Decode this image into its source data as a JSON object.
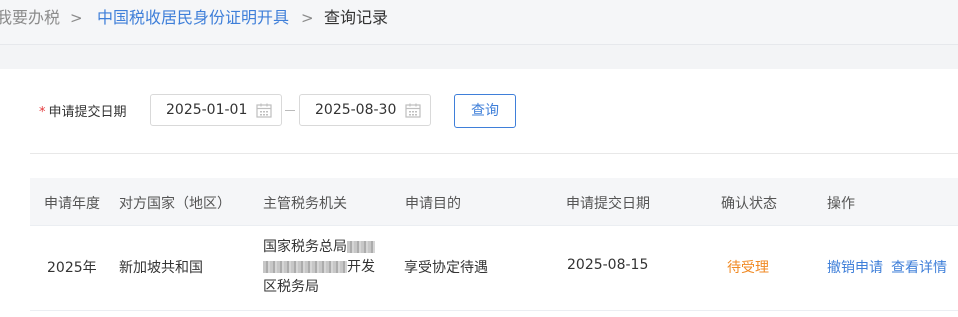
{
  "breadcrumb": {
    "items": [
      "我要办税",
      "中国税收居民身份证明开具",
      "查询记录"
    ],
    "separator": ">"
  },
  "filter": {
    "required_mark": "*",
    "label": "申请提交日期",
    "start_date": "2025-01-01",
    "end_date": "2025-08-30",
    "query_button": "查询"
  },
  "table": {
    "headers": [
      "申请年度",
      "对方国家（地区）",
      "主管税务机关",
      "申请目的",
      "申请提交日期",
      "确认状态",
      "操作"
    ],
    "rows": [
      {
        "year": "2025年",
        "country": "新加坡共和国",
        "authority_line1": "国家税务总局",
        "authority_line2_tail": "开发",
        "authority_line3": "区税务局",
        "purpose": "享受协定待遇",
        "submit_date": "2025-08-15",
        "status": "待受理",
        "actions": [
          "撤销申请",
          "查看详情"
        ]
      }
    ]
  },
  "colors": {
    "link": "#3f7fd9",
    "status_pending": "#f08a24",
    "required": "#e4393c"
  }
}
